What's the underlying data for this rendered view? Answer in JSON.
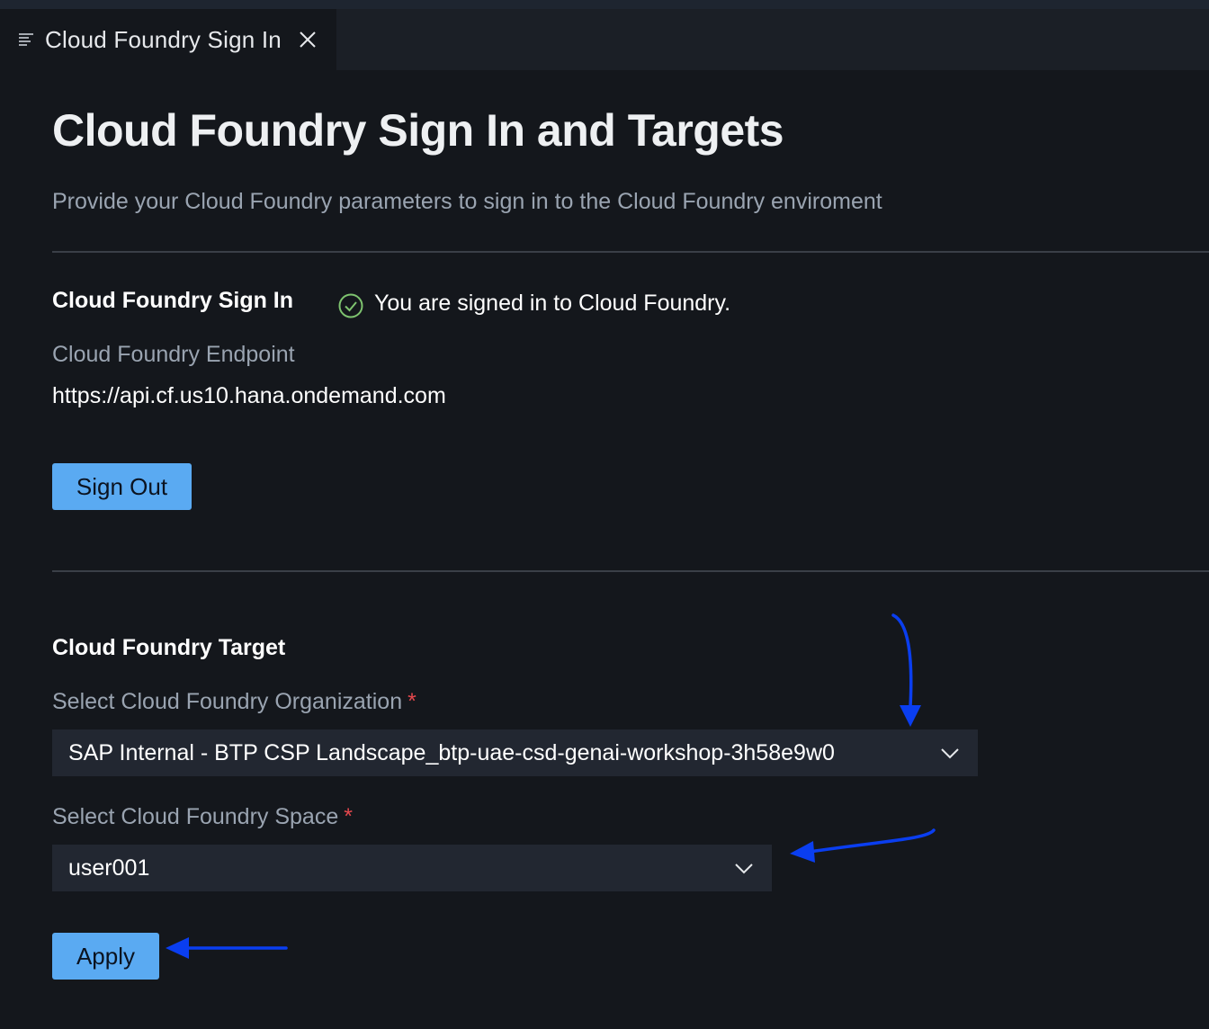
{
  "tab": {
    "label": "Cloud Foundry Sign In"
  },
  "page": {
    "title": "Cloud Foundry Sign In and Targets",
    "subtitle": "Provide your Cloud Foundry parameters to sign in to the Cloud Foundry enviroment"
  },
  "sign_in": {
    "heading": "Cloud Foundry Sign In",
    "status_text": "You are signed in to Cloud Foundry.",
    "endpoint_label": "Cloud Foundry Endpoint",
    "endpoint_value": "https://api.cf.us10.hana.ondemand.com",
    "sign_out_label": "Sign Out"
  },
  "target": {
    "heading": "Cloud Foundry Target",
    "org_label": "Select Cloud Foundry Organization",
    "org_value": "SAP Internal - BTP CSP Landscape_btp-uae-csd-genai-workshop-3h58e9w0",
    "space_label": "Select Cloud Foundry Space",
    "space_value": "user001",
    "required_marker": "*",
    "apply_label": "Apply"
  },
  "colors": {
    "background": "#14171c",
    "button": "#5aaaf2",
    "success": "#7ec36f",
    "required": "#e5484d",
    "annotation_arrow": "#0a3ef0"
  },
  "icons": {
    "tab": "lines-icon",
    "tab_close": "close-icon",
    "status": "check-circle-icon",
    "dropdown": "chevron-down-icon"
  }
}
